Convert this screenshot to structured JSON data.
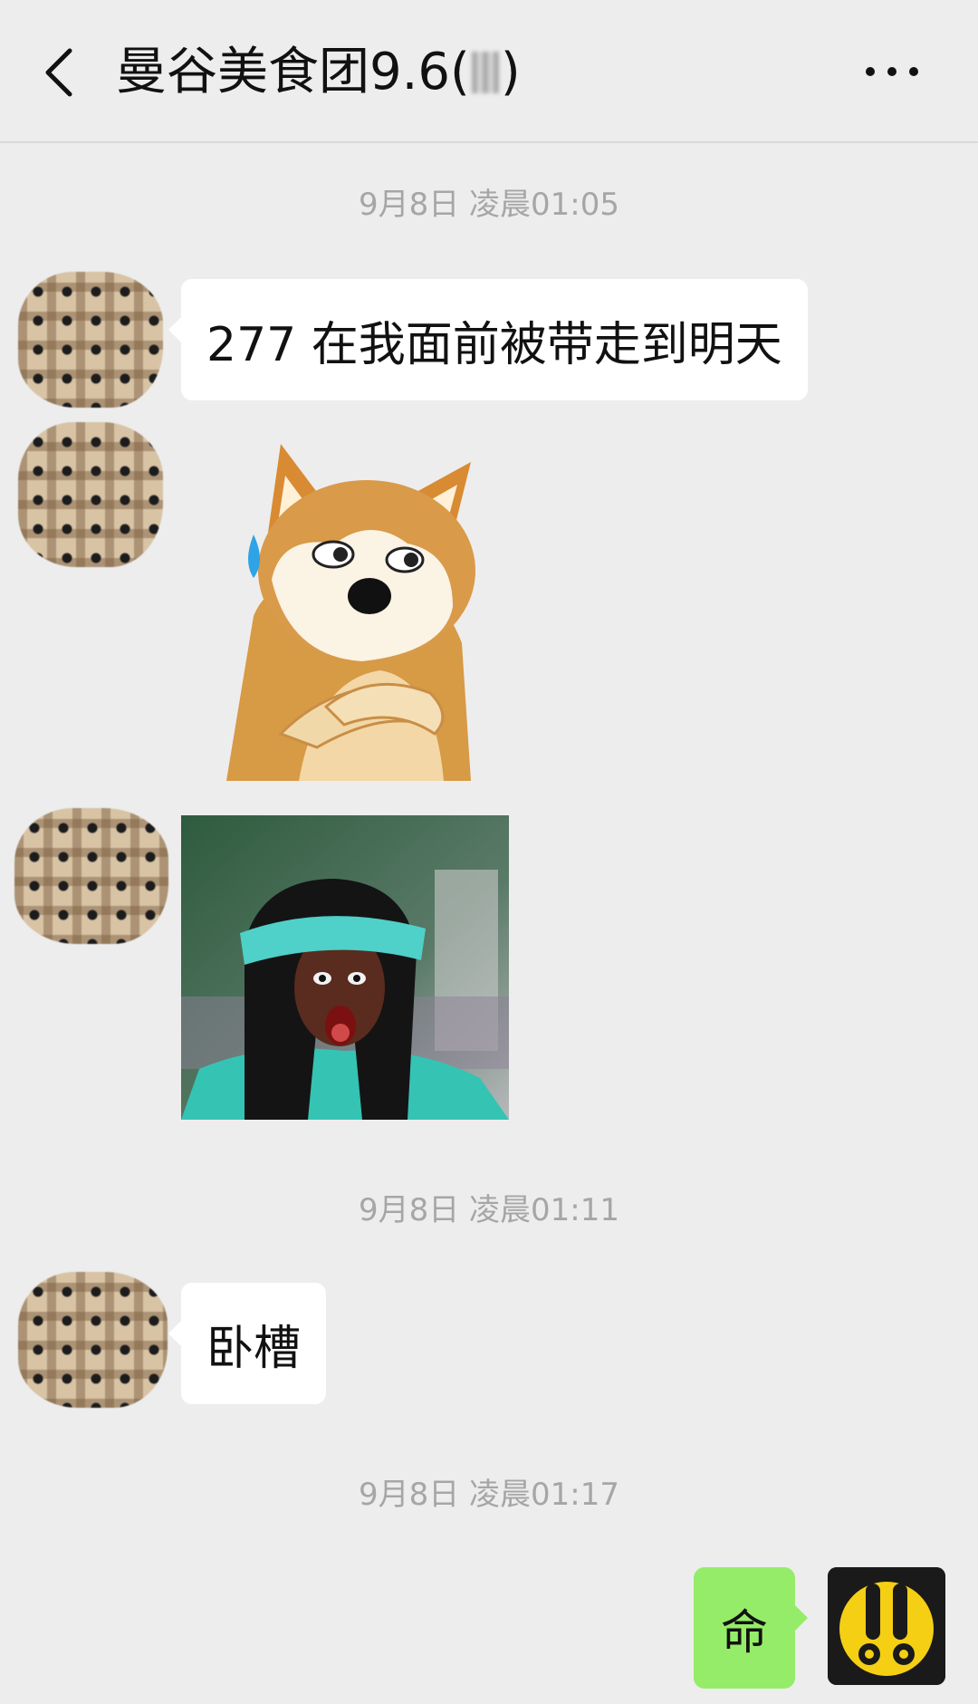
{
  "header": {
    "title": "曼谷美食团9.6(",
    "title_end": ")"
  },
  "icons": {
    "back": "chevron-left-icon",
    "more": "more-dots-icon"
  },
  "messages": {
    "time_1": "9月8日 凌晨01:05",
    "msg_1": "277 在我面前被带走到明天",
    "time_2": "9月8日 凌晨01:11",
    "msg_2": "卧槽",
    "time_3": "9月8日 凌晨01:17",
    "msg_3": "命"
  },
  "colors": {
    "background": "#ededed",
    "received_bubble": "#ffffff",
    "sent_bubble": "#95ec69",
    "timestamp": "#a6a6a6"
  }
}
